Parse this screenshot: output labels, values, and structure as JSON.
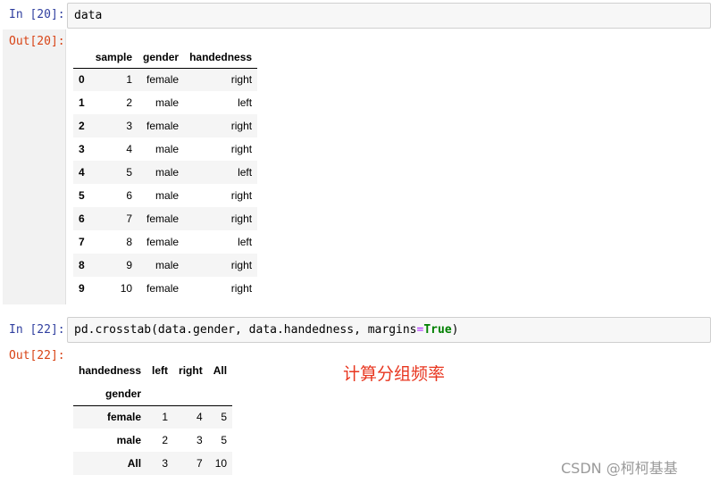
{
  "cell1": {
    "in_prompt": "In [20]:",
    "code": "data",
    "out_prompt": "Out[20]:",
    "table": {
      "columns": [
        "sample",
        "gender",
        "handedness"
      ],
      "rows": [
        {
          "index": "0",
          "sample": "1",
          "gender": "female",
          "handedness": "right"
        },
        {
          "index": "1",
          "sample": "2",
          "gender": "male",
          "handedness": "left"
        },
        {
          "index": "2",
          "sample": "3",
          "gender": "female",
          "handedness": "right"
        },
        {
          "index": "3",
          "sample": "4",
          "gender": "male",
          "handedness": "right"
        },
        {
          "index": "4",
          "sample": "5",
          "gender": "male",
          "handedness": "left"
        },
        {
          "index": "5",
          "sample": "6",
          "gender": "male",
          "handedness": "right"
        },
        {
          "index": "6",
          "sample": "7",
          "gender": "female",
          "handedness": "right"
        },
        {
          "index": "7",
          "sample": "8",
          "gender": "female",
          "handedness": "left"
        },
        {
          "index": "8",
          "sample": "9",
          "gender": "male",
          "handedness": "right"
        },
        {
          "index": "9",
          "sample": "10",
          "gender": "female",
          "handedness": "right"
        }
      ]
    }
  },
  "cell2": {
    "in_prompt": "In [22]:",
    "code_part1": "pd.crosstab(data.gender, data.handedness, margins",
    "code_op": "=",
    "code_true": "True",
    "code_part2": ")",
    "out_prompt": "Out[22]:",
    "table": {
      "columns_name": "handedness",
      "columns": [
        "left",
        "right",
        "All"
      ],
      "index_name": "gender",
      "rows": [
        {
          "index": "female",
          "left": "1",
          "right": "4",
          "All": "5"
        },
        {
          "index": "male",
          "left": "2",
          "right": "3",
          "All": "5"
        },
        {
          "index": "All",
          "left": "3",
          "right": "7",
          "All": "10"
        }
      ]
    }
  },
  "annotation": "计算分组频率",
  "watermark": "CSDN @柯柯基基",
  "colors": {
    "in_prompt": "#303F9F",
    "out_prompt": "#D84315",
    "annotation": "#E8361F",
    "keyword_true": "#008000",
    "operator": "#AA22FF"
  }
}
